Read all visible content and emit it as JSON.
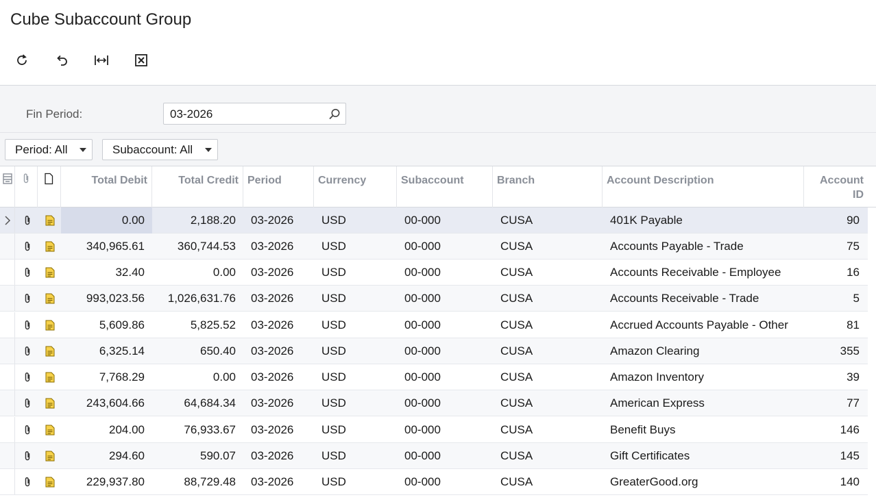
{
  "page": {
    "title": "Cube Subaccount Group"
  },
  "toolbar": {
    "buttons": [
      {
        "name": "refresh-button",
        "icon": "refresh-icon"
      },
      {
        "name": "undo-button",
        "icon": "undo-icon"
      },
      {
        "name": "fit-columns-button",
        "icon": "fit-width-icon"
      },
      {
        "name": "export-excel-button",
        "icon": "excel-icon"
      }
    ]
  },
  "filter": {
    "fin_period_label": "Fin Period:",
    "fin_period_value": "03-2026"
  },
  "dropdowns": {
    "period": "Period: All",
    "subaccount": "Subaccount: All"
  },
  "grid": {
    "headers": {
      "total_debit": "Total Debit",
      "total_credit": "Total Credit",
      "period": "Period",
      "currency": "Currency",
      "subaccount": "Subaccount",
      "branch": "Branch",
      "account_description": "Account Description",
      "account_id_1": "Account",
      "account_id_2": "ID"
    },
    "rows": [
      {
        "debit": "0.00",
        "credit": "2,188.20",
        "period": "03-2026",
        "currency": "USD",
        "subaccount": "00-000",
        "branch": "CUSA",
        "description": "401K Payable",
        "account_id": "90"
      },
      {
        "debit": "340,965.61",
        "credit": "360,744.53",
        "period": "03-2026",
        "currency": "USD",
        "subaccount": "00-000",
        "branch": "CUSA",
        "description": "Accounts Payable - Trade",
        "account_id": "75"
      },
      {
        "debit": "32.40",
        "credit": "0.00",
        "period": "03-2026",
        "currency": "USD",
        "subaccount": "00-000",
        "branch": "CUSA",
        "description": "Accounts Receivable - Employee",
        "account_id": "16"
      },
      {
        "debit": "993,023.56",
        "credit": "1,026,631.76",
        "period": "03-2026",
        "currency": "USD",
        "subaccount": "00-000",
        "branch": "CUSA",
        "description": "Accounts Receivable - Trade",
        "account_id": "5"
      },
      {
        "debit": "5,609.86",
        "credit": "5,825.52",
        "period": "03-2026",
        "currency": "USD",
        "subaccount": "00-000",
        "branch": "CUSA",
        "description": "Accrued Accounts Payable - Other",
        "account_id": "81"
      },
      {
        "debit": "6,325.14",
        "credit": "650.40",
        "period": "03-2026",
        "currency": "USD",
        "subaccount": "00-000",
        "branch": "CUSA",
        "description": "Amazon Clearing",
        "account_id": "355"
      },
      {
        "debit": "7,768.29",
        "credit": "0.00",
        "period": "03-2026",
        "currency": "USD",
        "subaccount": "00-000",
        "branch": "CUSA",
        "description": "Amazon Inventory",
        "account_id": "39"
      },
      {
        "debit": "243,604.66",
        "credit": "64,684.34",
        "period": "03-2026",
        "currency": "USD",
        "subaccount": "00-000",
        "branch": "CUSA",
        "description": "American Express",
        "account_id": "77"
      },
      {
        "debit": "204.00",
        "credit": "76,933.67",
        "period": "03-2026",
        "currency": "USD",
        "subaccount": "00-000",
        "branch": "CUSA",
        "description": "Benefit Buys",
        "account_id": "146"
      },
      {
        "debit": "294.60",
        "credit": "590.07",
        "period": "03-2026",
        "currency": "USD",
        "subaccount": "00-000",
        "branch": "CUSA",
        "description": "Gift Certificates",
        "account_id": "145"
      },
      {
        "debit": "229,937.80",
        "credit": "88,729.48",
        "period": "03-2026",
        "currency": "USD",
        "subaccount": "00-000",
        "branch": "CUSA",
        "description": "GreaterGood.org",
        "account_id": "140"
      }
    ]
  }
}
